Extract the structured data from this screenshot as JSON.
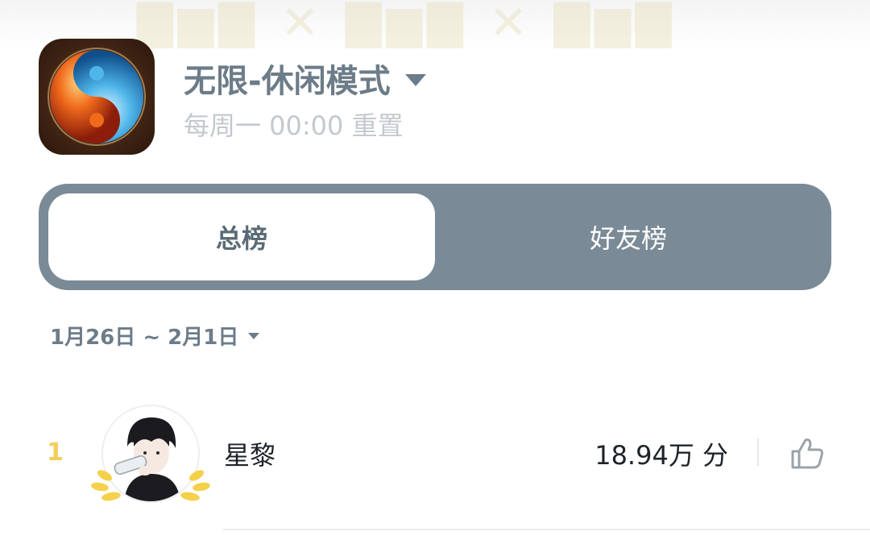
{
  "header": {
    "game_icon": "taiji-fire-ice-icon",
    "mode_title": "无限-休闲模式",
    "reset_text": "每周一 00:00 重置"
  },
  "tabs": [
    {
      "label": "总榜",
      "active": true
    },
    {
      "label": "好友榜",
      "active": false
    }
  ],
  "date_range": "1月26日 ~ 2月1日",
  "leaderboard": [
    {
      "rank": "1",
      "name": "星黎",
      "score": "18.94万 分",
      "avatar": "avatar-boy-with-bottle",
      "like_icon": "thumbs-up-icon"
    }
  ],
  "colors": {
    "accent": "#7a8a96",
    "title": "#6c7c88",
    "rank_gold": "#f2cf5b"
  }
}
